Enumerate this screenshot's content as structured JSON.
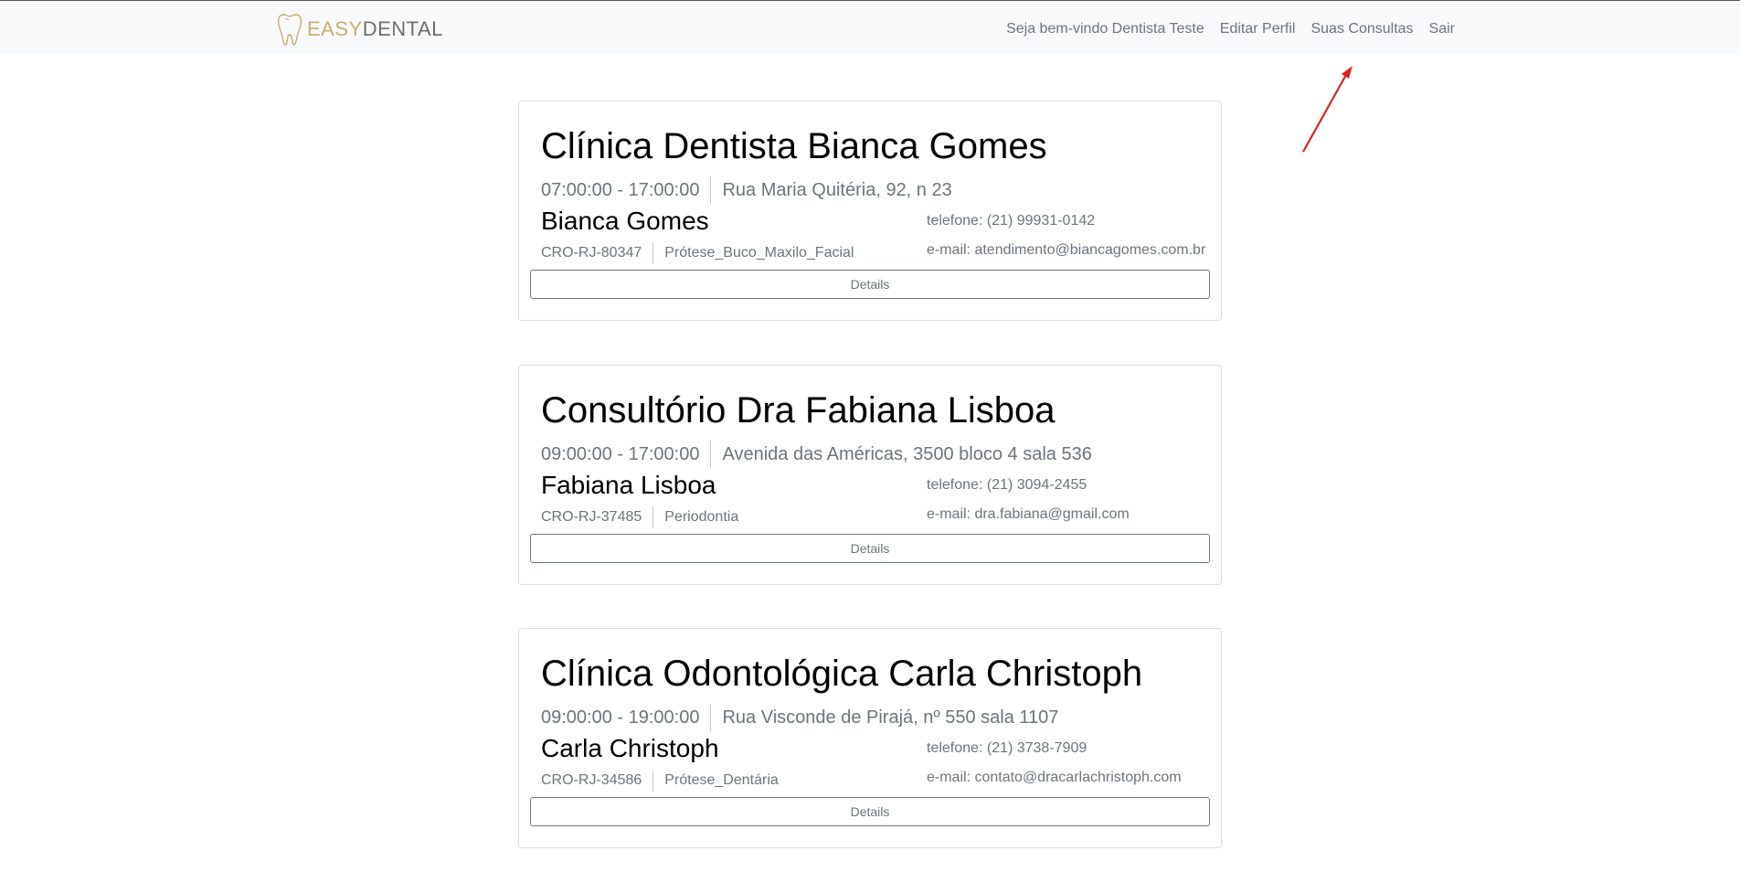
{
  "brand": {
    "name_part1": "EASY",
    "name_part2": "DENTAL",
    "icon": "tooth-icon"
  },
  "nav": {
    "welcome": "Seja bem-vindo Dentista Teste",
    "edit_profile": "Editar Perfil",
    "appointments": "Suas Consultas",
    "logout": "Sair"
  },
  "annotation": {
    "icon": "red-arrow-icon",
    "color": "#e02020"
  },
  "clinics": [
    {
      "title": "Clínica Dentista Bianca Gomes",
      "hours": "07:00:00 - 17:00:00",
      "address": "Rua Maria Quitéria, 92, n 23",
      "dentist": "Bianca Gomes",
      "cro": "CRO-RJ-80347",
      "specialty": "Prótese_Buco_Maxilo_Facial",
      "phone": "telefone: (21) 99931-0142",
      "email": "e-mail: atendimento@biancagomes.com.br",
      "button": "Details"
    },
    {
      "title": "Consultório Dra Fabiana Lisboa",
      "hours": "09:00:00 - 17:00:00",
      "address": "Avenida das Américas, 3500 bloco 4 sala 536",
      "dentist": "Fabiana Lisboa",
      "cro": "CRO-RJ-37485",
      "specialty": "Periodontia",
      "phone": "telefone: (21) 3094-2455",
      "email": "e-mail: dra.fabiana@gmail.com",
      "button": "Details"
    },
    {
      "title": "Clínica Odontológica Carla Christoph",
      "hours": "09:00:00 - 19:00:00",
      "address": "Rua Visconde de Pirajá, nº 550 sala 1107",
      "dentist": "Carla Christoph",
      "cro": "CRO-RJ-34586",
      "specialty": "Prótese_Dentária",
      "phone": "telefone: (21) 3738-7909",
      "email": "e-mail: contato@dracarlachristoph.com",
      "button": "Details"
    }
  ]
}
